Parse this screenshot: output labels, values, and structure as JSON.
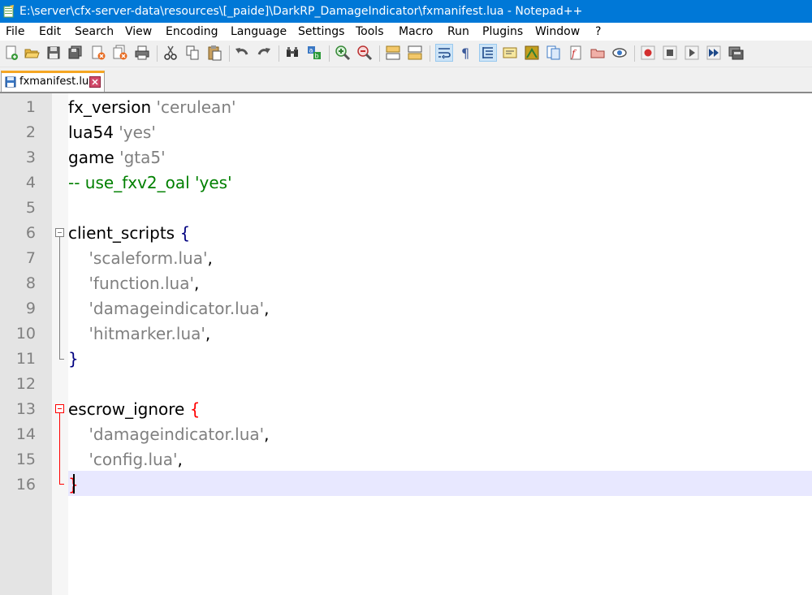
{
  "window": {
    "title": "E:\\server\\cfx-server-data\\resources\\[_paide]\\DarkRP_DamageIndicator\\fxmanifest.lua - Notepad++"
  },
  "menu": [
    "File",
    "Edit",
    "Search",
    "View",
    "Encoding",
    "Language",
    "Settings",
    "Tools",
    "Macro",
    "Run",
    "Plugins",
    "Window",
    "?"
  ],
  "toolbar": {
    "buttons": [
      "new-file-icon",
      "open-file-icon",
      "save-icon",
      "save-all-icon",
      "close-icon",
      "close-all-icon",
      "print-icon",
      "cut-icon",
      "copy-icon",
      "paste-icon",
      "undo-icon",
      "redo-icon",
      "find-icon",
      "replace-icon",
      "zoom-in-icon",
      "zoom-out-icon",
      "sync-vertical-icon",
      "sync-horizontal-icon",
      "word-wrap-icon",
      "show-all-characters-icon",
      "indent-guide-icon",
      "user-language-icon",
      "document-map-icon",
      "function-list-icon",
      "folder-workspace-icon",
      "monitoring-icon",
      "record-macro-icon",
      "stop-recording-icon",
      "playback-macro-icon",
      "run-macro-multiple-icon",
      "save-macro-icon"
    ]
  },
  "tab": {
    "label": "fxmanifest.lua"
  },
  "editor": {
    "line_numbers": [
      "1",
      "2",
      "3",
      "4",
      "5",
      "6",
      "7",
      "8",
      "9",
      "10",
      "11",
      "12",
      "13",
      "14",
      "15",
      "16"
    ],
    "lines": [
      {
        "id": "fx_version",
        "str": "'cerulean'"
      },
      {
        "id": "lua54",
        "str": "'yes'"
      },
      {
        "id": "game",
        "str": "'gta5'"
      },
      {
        "comment": "-- use_fxv2_oal 'yes'"
      },
      {},
      {
        "id": "client_scripts",
        "brace": "{"
      },
      {
        "str": "'scaleform.lua'",
        "punc": ","
      },
      {
        "str": "'function.lua'",
        "punc": ","
      },
      {
        "str": "'damageindicator.lua'",
        "punc": ","
      },
      {
        "str": "'hitmarker.lua'",
        "punc": ","
      },
      {
        "brace": "}"
      },
      {},
      {
        "id": "escrow_ignore",
        "brace": "{"
      },
      {
        "str": "'damageindicator.lua'",
        "punc": ","
      },
      {
        "str": "'config.lua'",
        "punc": ","
      },
      {
        "brace": "}"
      }
    ],
    "current_line": 16
  },
  "colors": {
    "titlebar": "#0078d7",
    "string": "#808080",
    "comment": "#008000",
    "brace": "#000080",
    "brace_highlight": "#ff0000",
    "current_line": "#e8e8ff"
  }
}
